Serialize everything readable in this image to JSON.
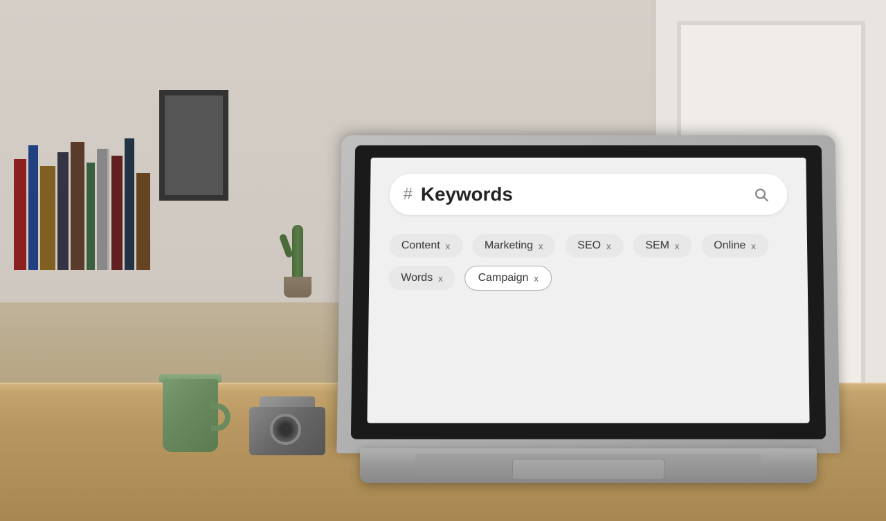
{
  "scene": {
    "background_color": "#c8b89a",
    "wall_color": "#d5cfc8"
  },
  "screen": {
    "search": {
      "hash_symbol": "#",
      "placeholder": "Keywords",
      "search_icon": "🔍"
    },
    "tags": [
      {
        "label": "Content",
        "removable": true,
        "x_label": "x",
        "selected": false
      },
      {
        "label": "Marketing",
        "removable": true,
        "x_label": "x",
        "selected": false
      },
      {
        "label": "SEO",
        "removable": true,
        "x_label": "x",
        "selected": false
      },
      {
        "label": "SEM",
        "removable": true,
        "x_label": "x",
        "selected": false
      },
      {
        "label": "Online",
        "removable": true,
        "x_label": "x",
        "selected": false
      },
      {
        "label": "Words",
        "removable": true,
        "x_label": "x",
        "selected": false
      },
      {
        "label": "Campaign",
        "removable": true,
        "x_label": "x",
        "selected": true
      }
    ]
  }
}
